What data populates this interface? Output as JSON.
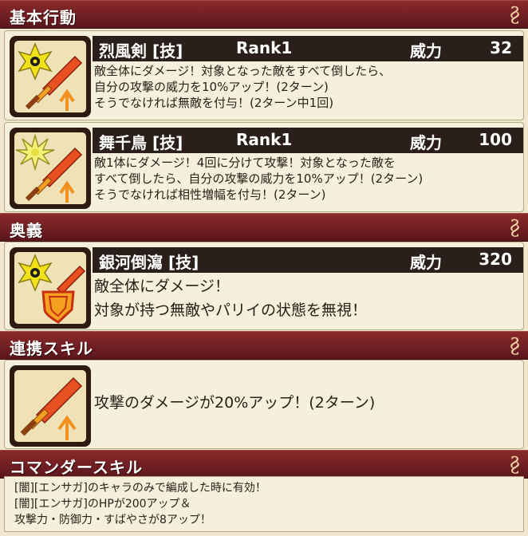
{
  "sections": {
    "basic": "基本行動",
    "ougi": "奥義",
    "link": "連携スキル",
    "commander": "コマンダースキル"
  },
  "power_label": "威力",
  "skills": [
    {
      "name": "烈風剣 [技]",
      "rank": "Rank1",
      "power": "32",
      "desc": [
        "敵全体にダメージ！対象となった敵をすべて倒したら、",
        "自分の攻撃の威力を10%アップ！(2ターン)",
        "そうでなければ無敵を付与！(2ターン中1回)"
      ]
    },
    {
      "name": "舞千鳥 [技]",
      "rank": "Rank1",
      "power": "100",
      "desc": [
        "敵1体にダメージ！4回に分けて攻撃！対象となった敵を",
        "すべて倒したら、自分の攻撃の威力を10%アップ！(2ターン)",
        "そうでなければ相性増幅を付与！(2ターン)"
      ]
    }
  ],
  "ougi": {
    "name": "銀河倒瀉 [技]",
    "power": "320",
    "desc": [
      "敵全体にダメージ！",
      "対象が持つ無敵やパリイの状態を無視！"
    ]
  },
  "link_skill": {
    "desc": "攻撃のダメージが20%アップ！(2ターン)"
  },
  "commander_skill": {
    "lines": [
      "[闇][エンサガ]のキャラのみで編成した時に有効！",
      "[闇][エンサガ]のHPが200アップ＆",
      "攻撃力・防御力・すばやさが8アップ！"
    ]
  },
  "colors": {
    "header": "#6e1e22",
    "namebar": "#2a1f1a",
    "panel": "#f6efdc",
    "background": "#f1e7ce"
  },
  "icons": [
    "sword-icon",
    "shuriken-icon",
    "starburst-icon",
    "shield-icon"
  ]
}
